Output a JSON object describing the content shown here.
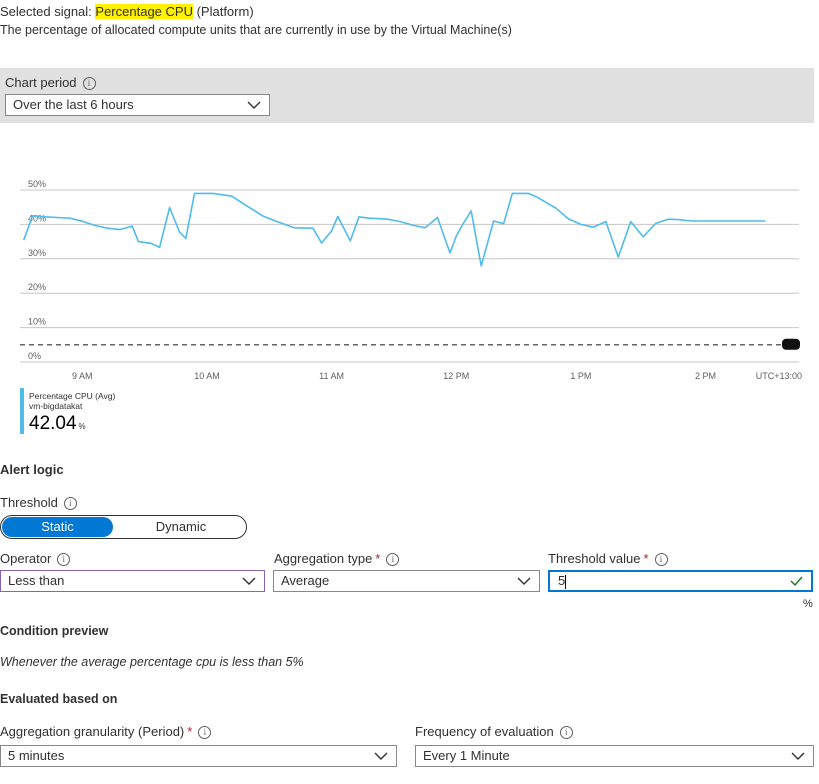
{
  "signal": {
    "prefix": "Selected signal:",
    "name": "Percentage CPU",
    "suffix": "(Platform)",
    "description": "The percentage of allocated compute units that are currently in use by the Virtual Machine(s)"
  },
  "chart_period": {
    "label": "Chart period",
    "value": "Over the last 6 hours"
  },
  "chart_data": {
    "type": "line",
    "y_ticks": [
      "50%",
      "40%",
      "30%",
      "20%",
      "10%",
      "0%"
    ],
    "x_ticks": [
      "9 AM",
      "10 AM",
      "11 AM",
      "12 PM",
      "1 PM",
      "2 PM"
    ],
    "timezone": "UTC+13:00",
    "ylim": [
      0,
      50
    ],
    "x_range": [
      8.5,
      14.75
    ],
    "threshold": 5,
    "series": [
      {
        "name": "Percentage CPU (Avg)",
        "color": "#4fbcea",
        "x": [
          8.53,
          8.6,
          8.7,
          8.8,
          8.9,
          9.0,
          9.1,
          9.2,
          9.3,
          9.4,
          9.45,
          9.55,
          9.62,
          9.7,
          9.78,
          9.83,
          9.9,
          9.98,
          10.05,
          10.2,
          10.3,
          10.38,
          10.45,
          10.55,
          10.7,
          10.85,
          10.92,
          11.0,
          11.05,
          11.15,
          11.22,
          11.3,
          11.37,
          11.45,
          11.55,
          11.65,
          11.75,
          11.85,
          11.95,
          12.0,
          12.05,
          12.12,
          12.2,
          12.3,
          12.38,
          12.45,
          12.52,
          12.58,
          12.65,
          12.72,
          12.8,
          12.9,
          13.0,
          13.1,
          13.2,
          13.3,
          13.4,
          13.5,
          13.6,
          13.7,
          13.78,
          13.85,
          13.9,
          13.97,
          14.02,
          14.07,
          14.15,
          14.25,
          14.35,
          14.48
        ],
        "y": [
          35.4,
          42.5,
          42.2,
          42.0,
          41.8,
          40.9,
          39.7,
          38.9,
          38.5,
          39.5,
          35.0,
          34.5,
          33.3,
          44.9,
          37.8,
          35.9,
          49.0,
          49.0,
          49.0,
          48.2,
          45.8,
          44.0,
          42.4,
          41.0,
          39.0,
          38.9,
          34.6,
          38.1,
          42.3,
          35.2,
          42.2,
          41.8,
          41.7,
          41.5,
          40.8,
          39.8,
          39.0,
          42.0,
          31.7,
          36.5,
          39.9,
          43.9,
          27.9,
          41.0,
          40.2,
          49.0,
          49.0,
          49.0,
          47.9,
          46.4,
          44.7,
          41.6,
          40.0,
          39.2,
          40.8,
          30.5,
          40.8,
          36.4,
          40.3,
          41.5,
          41.4,
          41.1,
          41.0,
          41.0,
          41.0,
          41.0,
          41.0,
          41.0,
          41.0,
          41.0
        ]
      }
    ],
    "legend": {
      "series_name": "Percentage CPU (Avg)",
      "resource": "vm-bigdatakat",
      "value": "42.04",
      "unit": "%"
    }
  },
  "alert_logic": {
    "title": "Alert logic",
    "threshold_label": "Threshold",
    "threshold_options": [
      "Static",
      "Dynamic"
    ],
    "threshold_selected": "Static",
    "operator": {
      "label": "Operator",
      "value": "Less than"
    },
    "aggregation_type": {
      "label": "Aggregation type",
      "value": "Average"
    },
    "threshold_value": {
      "label": "Threshold value",
      "value": "5",
      "unit": "%"
    }
  },
  "condition_preview": {
    "title": "Condition preview",
    "text": "Whenever the average percentage cpu is less than 5%"
  },
  "evaluated": {
    "title": "Evaluated based on",
    "granularity": {
      "label": "Aggregation granularity (Period)",
      "value": "5 minutes"
    },
    "frequency": {
      "label": "Frequency of evaluation",
      "value": "Every 1 Minute"
    }
  },
  "colors": {
    "accent": "#0078d4",
    "line": "#4fbcea",
    "highlight": "#fff100",
    "valid": "#107c10",
    "operator_border": "#8764b8"
  }
}
